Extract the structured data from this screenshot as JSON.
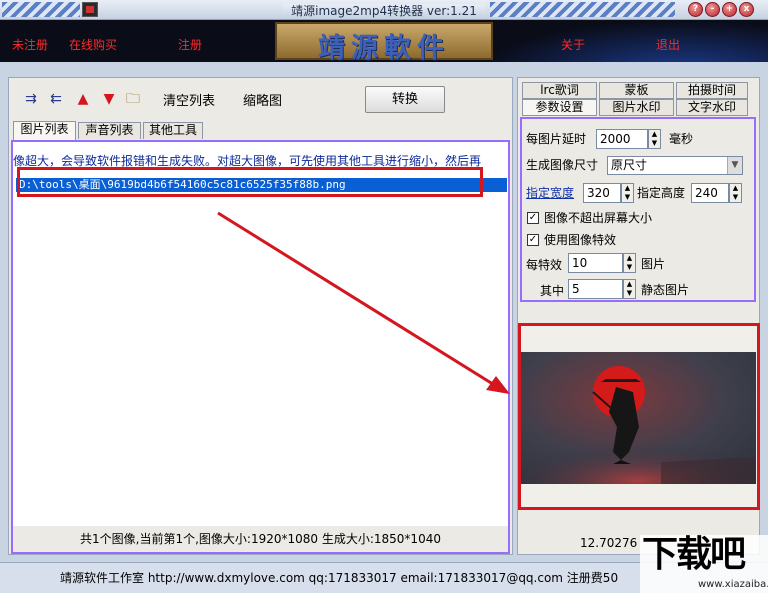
{
  "window": {
    "title": "靖源image2mp4转换器 ver:1.21",
    "buttons": [
      "?",
      "-",
      "+",
      "x"
    ]
  },
  "banner": {
    "links": [
      "未注册",
      "在线购买",
      "注册",
      "关于",
      "退出"
    ],
    "logo_text": "靖源軟件"
  },
  "toolbar": {
    "clear_list": "清空列表",
    "thumbnail": "缩略图",
    "convert": "转换"
  },
  "left_tabs": [
    "图片列表",
    "声音列表",
    "其他工具"
  ],
  "list": {
    "warning": "像超大，会导致软件报错和生成失败。对超大图像，可先使用其他工具进行缩小，然后再",
    "selected_item": "D:\\tools\\桌面\\9619bd4b6f54160c5c81c6525f35f88b.png",
    "status": "共1个图像,当前第1个,图像大小:1920*1080 生成大小:1850*1040"
  },
  "right_tabs": {
    "row1": [
      "lrc歌词",
      "蒙板",
      "拍摄时间"
    ],
    "row2": [
      "参数设置",
      "图片水印",
      "文字水印"
    ]
  },
  "settings": {
    "delay_label": "每图片延时",
    "delay_value": "2000",
    "delay_unit": "毫秒",
    "size_label": "生成图像尺寸",
    "size_value": "原尺寸",
    "width_label": "指定宽度",
    "width_value": "320",
    "height_label": "指定高度",
    "height_value": "240",
    "check1": "图像不超出屏幕大小",
    "check2": "使用图像特效",
    "per_effect_label": "每特效",
    "per_effect_value": "10",
    "per_effect_unit": "图片",
    "among_label": "其中",
    "among_value": "5",
    "among_unit": "静态图片"
  },
  "preview": {
    "time_text": "12.70276"
  },
  "footer": {
    "text": "靖源软件工作室 http://www.dxmylove.com qq:171833017 email:171833017@qq.com 注册费50"
  },
  "watermark": {
    "big": "下载吧",
    "small": "www.xiazaiba.com"
  },
  "colors": {
    "highlight_border": "#9a6bff",
    "annotation_red": "#d4161e",
    "selection_blue": "#0a5fd4"
  }
}
